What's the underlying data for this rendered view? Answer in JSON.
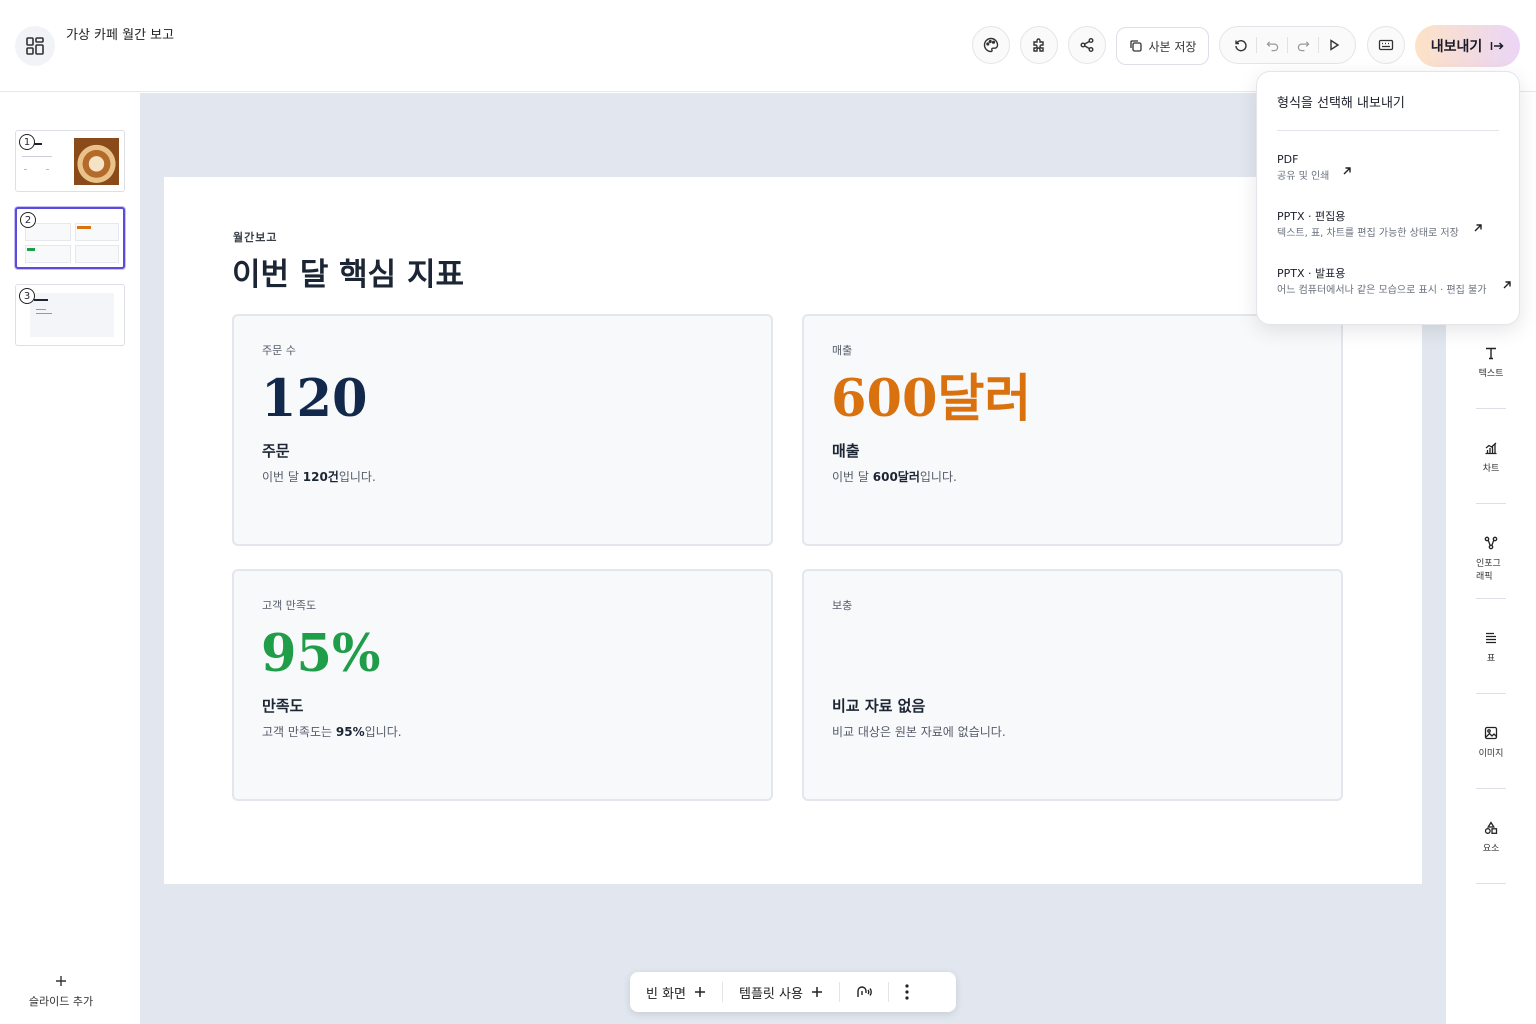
{
  "header": {
    "doc_title": "가상 카페 월간 보고",
    "copy_label": "사본 저장",
    "export_label": "내보내기"
  },
  "slides": {
    "numbers": [
      "1",
      "2",
      "3"
    ],
    "active_index": 2,
    "add_label": "슬라이드 추가"
  },
  "slide": {
    "kicker": "월간보고",
    "title": "이번 달 핵심 지표",
    "cards": [
      {
        "label": "주문 수",
        "value": "120",
        "value_color": "#13294b",
        "subtitle": "주문",
        "desc_pre": "이번 달 ",
        "desc_bold": "120건",
        "desc_post": "입니다."
      },
      {
        "label": "매출",
        "value": "600달러",
        "value_color": "#d9710f",
        "subtitle": "매출",
        "desc_pre": "이번 달 ",
        "desc_bold": "600달러",
        "desc_post": "입니다."
      },
      {
        "label": "고객 만족도",
        "value": "95%",
        "value_color": "#1f9d48",
        "subtitle": "만족도",
        "desc_pre": "고객 만족도는 ",
        "desc_bold": "95%",
        "desc_post": "입니다."
      },
      {
        "label": "보충",
        "value": "",
        "value_color": "#13294b",
        "subtitle": "비교 자료 없음",
        "desc_pre": "비교 대상은 원본 자료에 없습니다.",
        "desc_bold": "",
        "desc_post": ""
      }
    ]
  },
  "bottom_bar": {
    "blank_label": "빈 화면",
    "template_label": "템플릿 사용"
  },
  "right_tools": [
    "텍스트",
    "차트",
    "인포그래픽",
    "표",
    "이미지",
    "요소"
  ],
  "export_menu": {
    "title": "형식을 선택해 내보내기",
    "options": [
      {
        "name": "PDF",
        "desc": "공유 및 인쇄"
      },
      {
        "name": "PPTX · 편집용",
        "desc": "텍스트, 표, 차트를 편집 가능한 상태로 저장"
      },
      {
        "name": "PPTX · 발표용",
        "desc": "어느 컴퓨터에서나 같은 모습으로 표시 · 편집 불가"
      }
    ]
  },
  "colors": {
    "accent": "#5b4bdb",
    "canvas_bg": "#e2e7ef"
  }
}
